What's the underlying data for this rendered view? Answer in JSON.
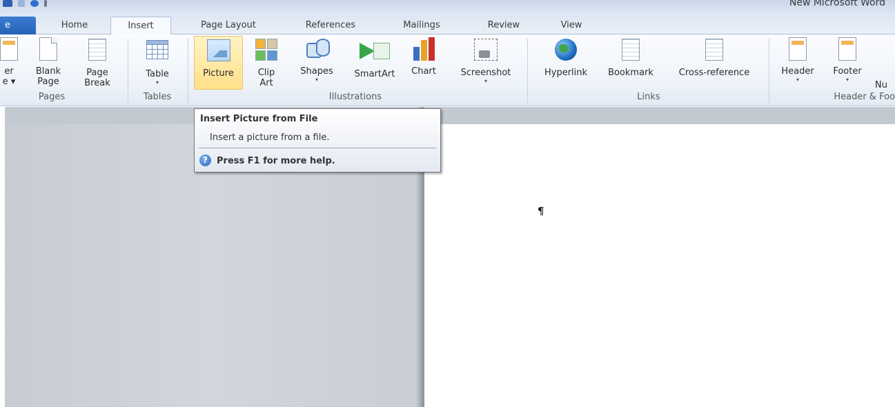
{
  "window": {
    "title": "New Microsoft Word"
  },
  "tabs": [
    {
      "label": "e"
    },
    {
      "label": "Home"
    },
    {
      "label": "Insert"
    },
    {
      "label": "Page Layout"
    },
    {
      "label": "References"
    },
    {
      "label": "Mailings"
    },
    {
      "label": "Review"
    },
    {
      "label": "View"
    }
  ],
  "ribbon": {
    "cover": {
      "label1": "er",
      "label2": "e ▾"
    },
    "blank_page": {
      "label1": "Blank",
      "label2": "Page"
    },
    "page_break": {
      "label1": "Page",
      "label2": "Break"
    },
    "pages_group": "Pages",
    "table": {
      "label": "Table",
      "arrow": "▾"
    },
    "tables_group": "Tables",
    "picture": {
      "label": "Picture"
    },
    "clip_art": {
      "label1": "Clip",
      "label2": "Art"
    },
    "shapes": {
      "label": "Shapes",
      "arrow": "▾"
    },
    "smartart": {
      "label": "SmartArt"
    },
    "chart": {
      "label": "Chart"
    },
    "screenshot": {
      "label": "Screenshot",
      "arrow": "▾"
    },
    "illustrations_group": "Illustrations",
    "hyperlink": {
      "label": "Hyperlink"
    },
    "bookmark": {
      "label": "Bookmark"
    },
    "cross_reference": {
      "label": "Cross-reference"
    },
    "links_group": "Links",
    "header": {
      "label": "Header",
      "arrow": "▾"
    },
    "footer": {
      "label": "Footer",
      "arrow": "▾"
    },
    "number": {
      "label": "Nu"
    },
    "header_footer_group": "Header & Foo"
  },
  "tooltip": {
    "title": "Insert Picture from File",
    "description": "Insert a picture from a file.",
    "help": "Press F1 for more help.",
    "help_icon_glyph": "?"
  },
  "document": {
    "pilcrow": "¶"
  },
  "colors": {
    "file_tab": "#2563b8",
    "selected_button": "#ffe08a",
    "workspace": "#c9ced5"
  }
}
